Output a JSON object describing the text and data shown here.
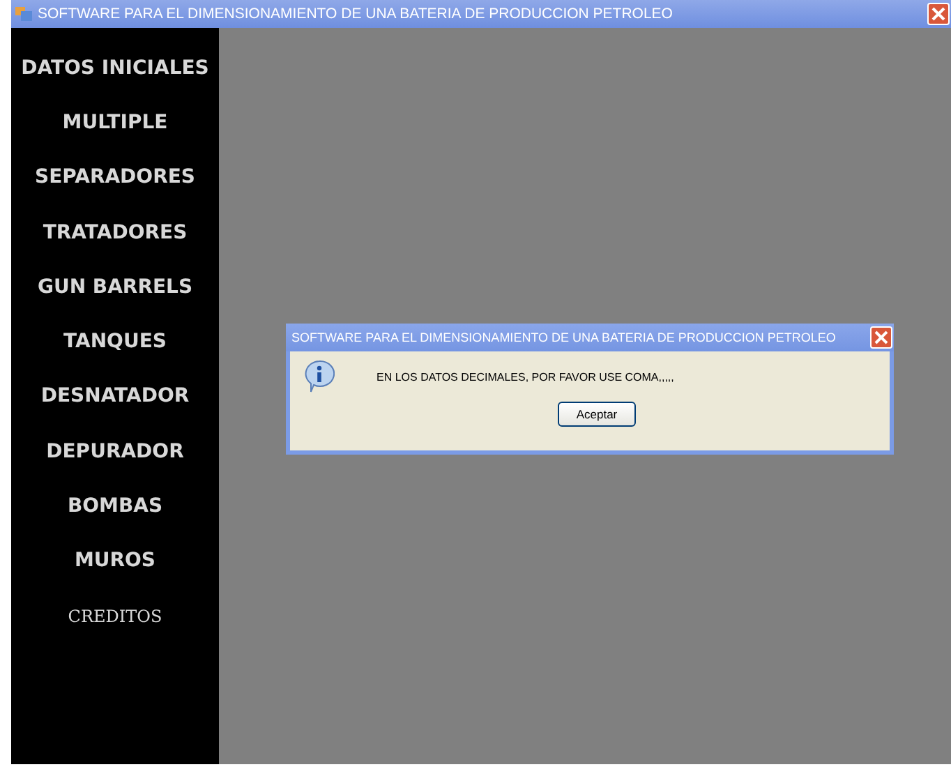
{
  "window": {
    "title": "SOFTWARE PARA EL DIMENSIONAMIENTO DE UNA BATERIA DE PRODUCCION PETROLEO"
  },
  "sidebar": {
    "items": [
      {
        "label": "DATOS INICIALES",
        "kind": "bold"
      },
      {
        "label": "MULTIPLE",
        "kind": "bold"
      },
      {
        "label": "SEPARADORES",
        "kind": "bold"
      },
      {
        "label": "TRATADORES",
        "kind": "bold"
      },
      {
        "label": "GUN BARRELS",
        "kind": "bold"
      },
      {
        "label": "TANQUES",
        "kind": "bold"
      },
      {
        "label": "DESNATADOR",
        "kind": "bold"
      },
      {
        "label": "DEPURADOR",
        "kind": "bold"
      },
      {
        "label": "BOMBAS",
        "kind": "bold"
      },
      {
        "label": "MUROS",
        "kind": "bold"
      },
      {
        "label": "CREDITOS",
        "kind": "plain"
      }
    ]
  },
  "dialog": {
    "title": "SOFTWARE PARA EL DIMENSIONAMIENTO DE UNA BATERIA DE PRODUCCION PETROLEO",
    "message": "EN LOS DATOS DECIMALES, POR FAVOR USE COMA,,,,,",
    "button": "Aceptar"
  }
}
